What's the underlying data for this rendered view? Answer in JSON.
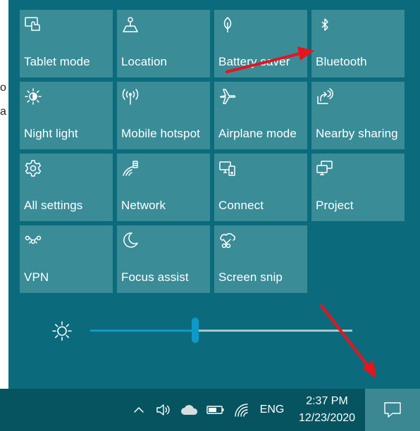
{
  "backdrop": {
    "fragments": [
      "o",
      "a"
    ]
  },
  "quick_actions": [
    {
      "label": "Tablet mode",
      "icon": "tablet-mode-icon"
    },
    {
      "label": "Location",
      "icon": "location-icon"
    },
    {
      "label": "Battery saver",
      "icon": "battery-saver-icon"
    },
    {
      "label": "Bluetooth",
      "icon": "bluetooth-icon"
    },
    {
      "label": "Night light",
      "icon": "night-light-icon"
    },
    {
      "label": "Mobile hotspot",
      "icon": "mobile-hotspot-icon"
    },
    {
      "label": "Airplane mode",
      "icon": "airplane-icon"
    },
    {
      "label": "Nearby sharing",
      "icon": "nearby-sharing-icon"
    },
    {
      "label": "All settings",
      "icon": "gear-icon"
    },
    {
      "label": "Network",
      "icon": "network-icon"
    },
    {
      "label": "Connect",
      "icon": "connect-icon"
    },
    {
      "label": "Project",
      "icon": "project-icon"
    },
    {
      "label": "VPN",
      "icon": "vpn-icon"
    },
    {
      "label": "Focus assist",
      "icon": "moon-icon"
    },
    {
      "label": "Screen snip",
      "icon": "screen-snip-icon"
    }
  ],
  "brightness": {
    "icon": "brightness-sun-icon",
    "level": 0.4
  },
  "annotations": {
    "color": "#e8141c"
  },
  "taskbar": {
    "tray_icons": [
      "chevron-up-icon",
      "volume-icon",
      "onedrive-cloud-icon",
      "battery-icon",
      "wifi-icon"
    ],
    "language": "ENG",
    "time": "2:37 PM",
    "date": "12/23/2020",
    "action_center_icon": "action-center-icon"
  },
  "colors": {
    "panel": "#0b6b7c",
    "tile": "#3a8c97",
    "taskbar": "#06545f",
    "slider_accent": "#0e9ac9"
  }
}
